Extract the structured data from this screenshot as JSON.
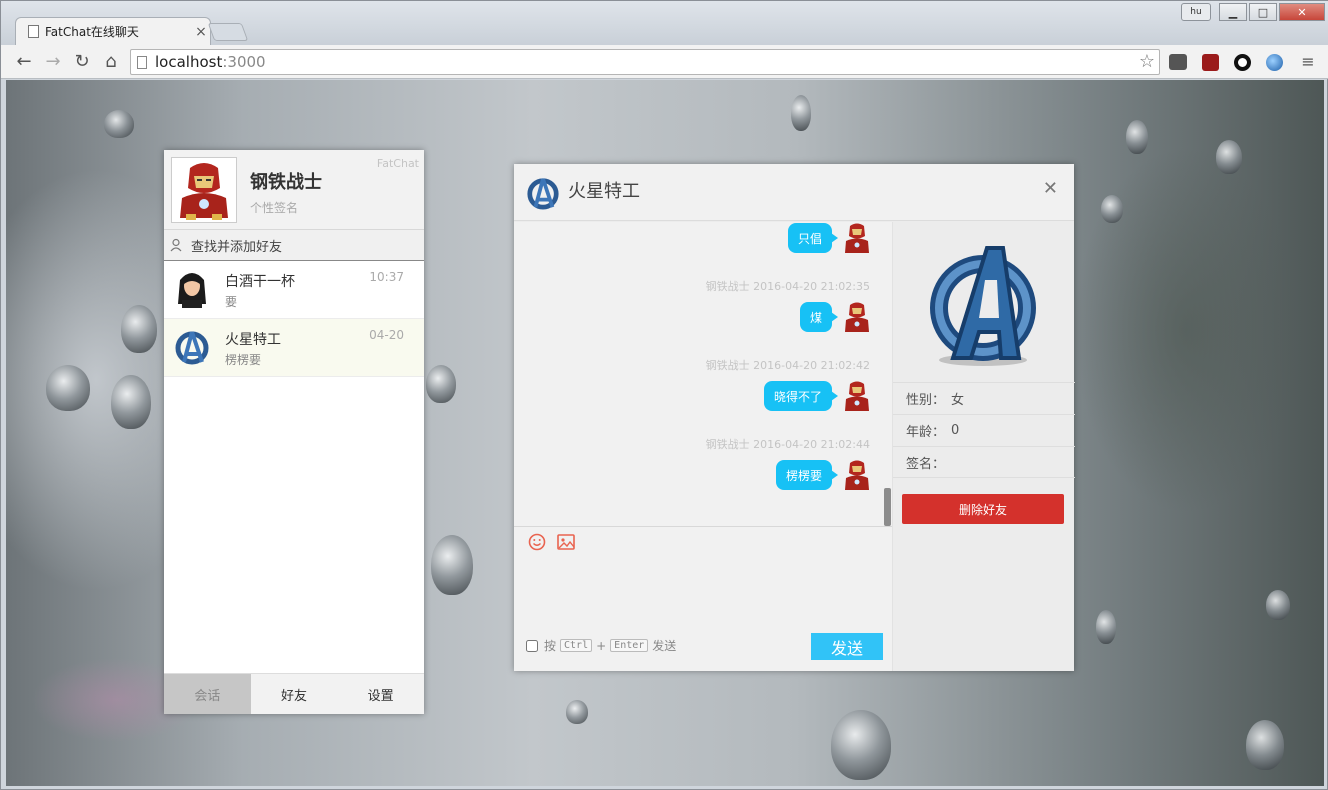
{
  "browser": {
    "tab_title": "FatChat在线聊天",
    "url_host": "localhost",
    "url_port": ":3000",
    "profile_label": "hu"
  },
  "sidebar": {
    "brand": "FatChat",
    "user": {
      "name": "钢铁战士",
      "signature": "个性签名"
    },
    "search_label": "查找并添加好友",
    "conversations": [
      {
        "name": "白酒干一杯",
        "last_message": "要",
        "time": "10:37"
      },
      {
        "name": "火星特工",
        "last_message": "楞楞要",
        "time": "04-20"
      }
    ],
    "tabs": [
      {
        "label": "会话"
      },
      {
        "label": "好友"
      },
      {
        "label": "设置"
      }
    ]
  },
  "chat": {
    "title": "火星特工",
    "messages": [
      {
        "meta": "",
        "text": "只倡"
      },
      {
        "meta": "钢铁战士 2016-04-20 21:02:35",
        "text": "煤"
      },
      {
        "meta": "钢铁战士 2016-04-20 21:02:42",
        "text": "晓得不了"
      },
      {
        "meta": "钢铁战士 2016-04-20 21:02:44",
        "text": "楞楞要"
      }
    ],
    "composer": {
      "hint_press": "按",
      "key_ctrl": "Ctrl",
      "plus": "+",
      "key_enter": "Enter",
      "hint_send": "发送",
      "send_label": "发送"
    },
    "profile": {
      "gender_label": "性别：",
      "gender": "女",
      "age_label": "年龄：",
      "age": "0",
      "sig_label": "签名：",
      "sig": "",
      "delete_label": "删除好友"
    }
  },
  "colors": {
    "accent": "#17c1f5",
    "send_button": "#31c3f7",
    "danger": "#d4312c"
  }
}
